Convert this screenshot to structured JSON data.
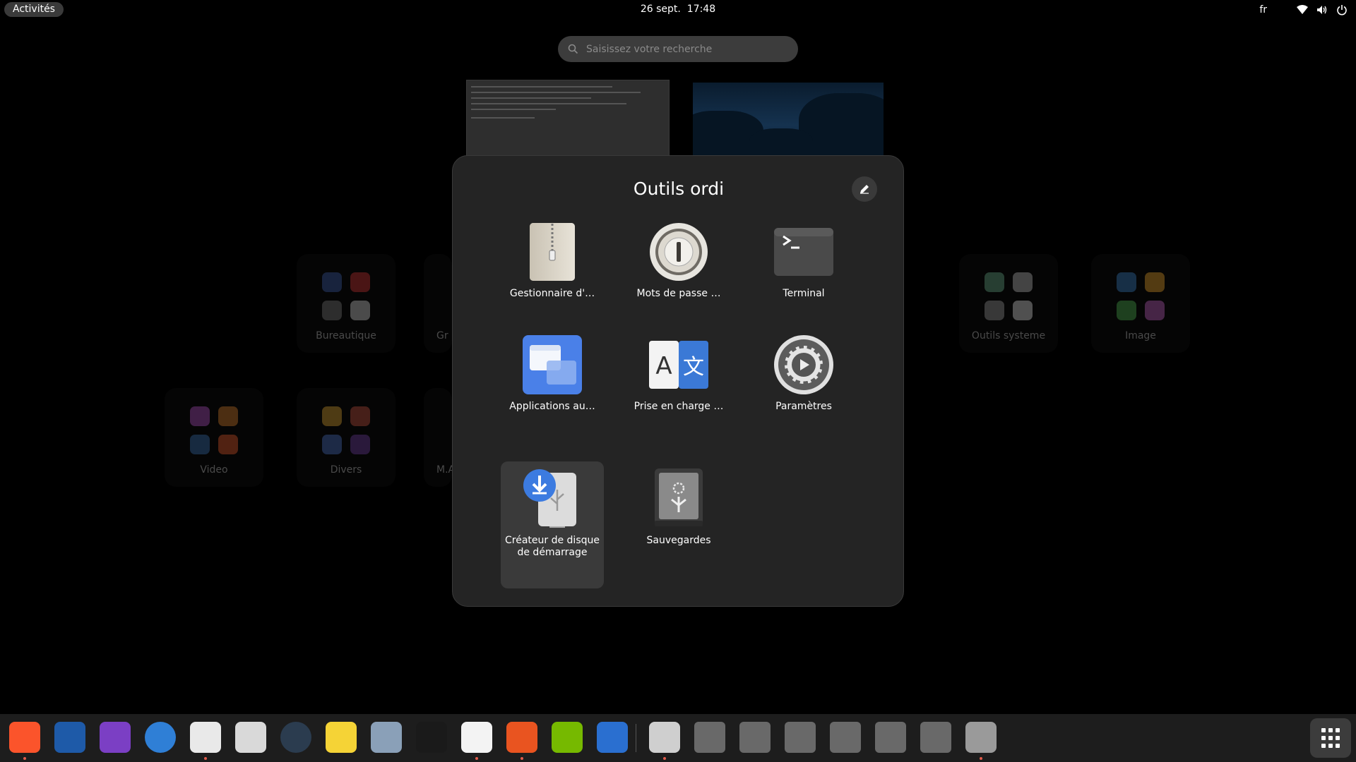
{
  "topbar": {
    "activities": "Activités",
    "date": "26 sept.",
    "time": "17:48",
    "lang": "fr"
  },
  "search": {
    "placeholder": "Saisissez votre recherche"
  },
  "background_folders": [
    {
      "label": "Bureautique"
    },
    {
      "label": "Gr"
    },
    {
      "label": "Outils systeme"
    },
    {
      "label": "Image"
    },
    {
      "label": "Video"
    },
    {
      "label": "Divers"
    },
    {
      "label": "M.A"
    }
  ],
  "folder_popup": {
    "title": "Outils ordi",
    "apps": [
      {
        "name": "Gestionnaire d'…",
        "icon": "archive-manager-icon"
      },
      {
        "name": "Mots de passe …",
        "icon": "passwords-keys-icon"
      },
      {
        "name": "Terminal",
        "icon": "terminal-icon"
      },
      {
        "name": "Applications au…",
        "icon": "startup-applications-icon"
      },
      {
        "name": "Prise en charge …",
        "icon": "language-support-icon"
      },
      {
        "name": "Paramètres",
        "icon": "settings-gear-icon"
      },
      {
        "name": "Créateur de disque de démarrage",
        "icon": "startup-disk-creator-icon"
      },
      {
        "name": "Sauvegardes",
        "icon": "backups-safe-icon"
      }
    ]
  },
  "dock": {
    "items": [
      {
        "icon": "brave-browser-icon",
        "color": "#fb542b",
        "running": true
      },
      {
        "icon": "tor-bird-icon",
        "color": "#1e5aa8",
        "running": false
      },
      {
        "icon": "tasks-check-icon",
        "color": "#7b3fc4",
        "running": false
      },
      {
        "icon": "thunderbird-icon",
        "color": "#2f7fd6",
        "running": false
      },
      {
        "icon": "file-manager-icon",
        "color": "#e9e9e9",
        "running": true
      },
      {
        "icon": "document-viewer-icon",
        "color": "#d9d9d9",
        "running": false
      },
      {
        "icon": "system-monitor-gauge-icon",
        "color": "#2b3c4f",
        "running": false
      },
      {
        "icon": "notes-pencil-icon",
        "color": "#f5d336",
        "running": false
      },
      {
        "icon": "favorites-star-icon",
        "color": "#8aa0b8",
        "running": false
      },
      {
        "icon": "arc-drawing-icon",
        "color": "#1a1a1a",
        "running": false
      },
      {
        "icon": "text-editor-icon",
        "color": "#f3f3f3",
        "running": true
      },
      {
        "icon": "software-center-icon",
        "color": "#e95420",
        "running": true
      },
      {
        "icon": "nvidia-settings-icon",
        "color": "#76b900",
        "running": false
      },
      {
        "icon": "activity-monitor-icon",
        "color": "#2a6fd0",
        "running": false
      },
      {
        "icon": "trash-recycle-icon",
        "color": "#cfcfcf",
        "running": true
      },
      {
        "icon": "disk-drive-icon",
        "color": "#777777",
        "running": false
      },
      {
        "icon": "disk-drive-icon",
        "color": "#777777",
        "running": false
      },
      {
        "icon": "disk-drive-icon",
        "color": "#777777",
        "running": false
      },
      {
        "icon": "disk-drive-icon",
        "color": "#777777",
        "running": false
      },
      {
        "icon": "disk-drive-icon",
        "color": "#777777",
        "running": false
      },
      {
        "icon": "disk-drive-icon",
        "color": "#777777",
        "running": false
      },
      {
        "icon": "usb-drive-icon",
        "color": "#9a9a9a",
        "running": true
      }
    ]
  },
  "colors": {
    "panel_bg": "#242424",
    "focused_bg": "#3a3a3a",
    "running_dot": "#e35b4a"
  }
}
